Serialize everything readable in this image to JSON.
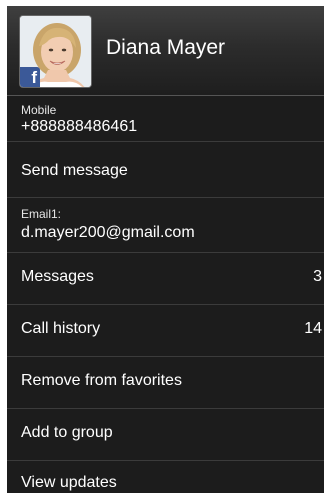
{
  "contact": {
    "name": "Diana Mayer",
    "avatar_badge": "f",
    "avatar_badge_icon": "facebook-icon"
  },
  "fields": {
    "mobile_label": "Mobile",
    "mobile_value": "+888888486461",
    "email_label": "Email1:",
    "email_value": "d.mayer200@gmail.com"
  },
  "actions": {
    "send_message": "Send message",
    "messages": "Messages",
    "messages_count": "3",
    "call_history": "Call history",
    "call_history_count": "14",
    "remove_favorites": "Remove from favorites",
    "add_to_group": "Add to group",
    "view_updates": "View updates"
  },
  "colors": {
    "background": "#1c1c1c",
    "text": "#ffffff",
    "divider": "#3b3b3b",
    "facebook_blue": "#3b5998"
  }
}
